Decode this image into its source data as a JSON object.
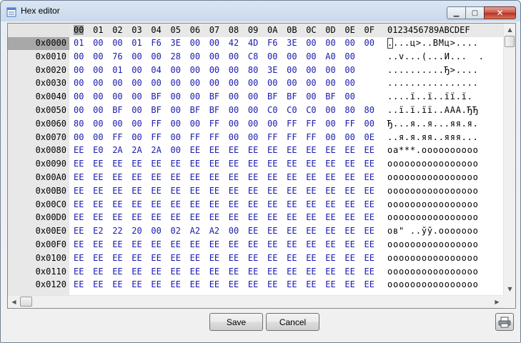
{
  "window": {
    "title": "Hex editor"
  },
  "header": {
    "columns": [
      "00",
      "01",
      "02",
      "03",
      "04",
      "05",
      "06",
      "07",
      "08",
      "09",
      "0A",
      "0B",
      "0C",
      "0D",
      "0E",
      "0F"
    ],
    "ascii_header": "0123456789ABCDEF"
  },
  "rows": [
    {
      "addr": "0x0000",
      "bytes": [
        "01",
        "00",
        "00",
        "01",
        "F6",
        "3E",
        "00",
        "00",
        "42",
        "4D",
        "F6",
        "3E",
        "00",
        "00",
        "00",
        "00"
      ],
      "ascii": "....ц>..BMц>...."
    },
    {
      "addr": "0x0010",
      "bytes": [
        "00",
        "00",
        "76",
        "00",
        "00",
        "28",
        "00",
        "00",
        "00",
        "C8",
        "00",
        "00",
        "00",
        "A0",
        "00",
        ""
      ],
      "ascii": "..v...(...И...  ."
    },
    {
      "addr": "0x0020",
      "bytes": [
        "00",
        "00",
        "01",
        "00",
        "04",
        "00",
        "00",
        "00",
        "00",
        "80",
        "3E",
        "00",
        "00",
        "00",
        "00",
        ""
      ],
      "ascii": "..........Ђ>...."
    },
    {
      "addr": "0x0030",
      "bytes": [
        "00",
        "00",
        "00",
        "00",
        "00",
        "00",
        "00",
        "00",
        "00",
        "00",
        "00",
        "00",
        "00",
        "00",
        "00",
        ""
      ],
      "ascii": "................"
    },
    {
      "addr": "0x0040",
      "bytes": [
        "00",
        "00",
        "00",
        "00",
        "BF",
        "00",
        "00",
        "BF",
        "00",
        "00",
        "BF",
        "BF",
        "00",
        "BF",
        "00",
        ""
      ],
      "ascii": "....ї..ї..її.ї."
    },
    {
      "addr": "0x0050",
      "bytes": [
        "00",
        "00",
        "BF",
        "00",
        "BF",
        "00",
        "BF",
        "BF",
        "00",
        "00",
        "C0",
        "C0",
        "C0",
        "00",
        "80",
        "80"
      ],
      "ascii": "..ї.ї.її..ААА.ЂЂ"
    },
    {
      "addr": "0x0060",
      "bytes": [
        "80",
        "00",
        "00",
        "00",
        "FF",
        "00",
        "00",
        "FF",
        "00",
        "00",
        "00",
        "FF",
        "FF",
        "00",
        "FF",
        "00"
      ],
      "ascii": "Ђ...я..я...яя.я."
    },
    {
      "addr": "0x0070",
      "bytes": [
        "00",
        "00",
        "FF",
        "00",
        "FF",
        "00",
        "FF",
        "FF",
        "00",
        "00",
        "FF",
        "FF",
        "FF",
        "00",
        "00",
        "0E"
      ],
      "ascii": "..я.я.яя..яяя..."
    },
    {
      "addr": "0x0080",
      "bytes": [
        "EE",
        "E0",
        "2A",
        "2A",
        "2A",
        "00",
        "EE",
        "EE",
        "EE",
        "EE",
        "EE",
        "EE",
        "EE",
        "EE",
        "EE",
        "EE"
      ],
      "ascii": "оа***.oooooooooo"
    },
    {
      "addr": "0x0090",
      "bytes": [
        "EE",
        "EE",
        "EE",
        "EE",
        "EE",
        "EE",
        "EE",
        "EE",
        "EE",
        "EE",
        "EE",
        "EE",
        "EE",
        "EE",
        "EE",
        "EE"
      ],
      "ascii": "oooooooooooooooo"
    },
    {
      "addr": "0x00A0",
      "bytes": [
        "EE",
        "EE",
        "EE",
        "EE",
        "EE",
        "EE",
        "EE",
        "EE",
        "EE",
        "EE",
        "EE",
        "EE",
        "EE",
        "EE",
        "EE",
        "EE"
      ],
      "ascii": "oooooooooooooooo"
    },
    {
      "addr": "0x00B0",
      "bytes": [
        "EE",
        "EE",
        "EE",
        "EE",
        "EE",
        "EE",
        "EE",
        "EE",
        "EE",
        "EE",
        "EE",
        "EE",
        "EE",
        "EE",
        "EE",
        "EE"
      ],
      "ascii": "oooooooooooooooo"
    },
    {
      "addr": "0x00C0",
      "bytes": [
        "EE",
        "EE",
        "EE",
        "EE",
        "EE",
        "EE",
        "EE",
        "EE",
        "EE",
        "EE",
        "EE",
        "EE",
        "EE",
        "EE",
        "EE",
        "EE"
      ],
      "ascii": "oooooooooooooooo"
    },
    {
      "addr": "0x00D0",
      "bytes": [
        "EE",
        "EE",
        "EE",
        "EE",
        "EE",
        "EE",
        "EE",
        "EE",
        "EE",
        "EE",
        "EE",
        "EE",
        "EE",
        "EE",
        "EE",
        "EE"
      ],
      "ascii": "oooooooooooooooo"
    },
    {
      "addr": "0x00E0",
      "bytes": [
        "EE",
        "E2",
        "22",
        "20",
        "00",
        "02",
        "A2",
        "A2",
        "00",
        "EE",
        "EE",
        "EE",
        "EE",
        "EE",
        "EE",
        "EE"
      ],
      "ascii": "ов\" ..ўў.ooooooo"
    },
    {
      "addr": "0x00F0",
      "bytes": [
        "EE",
        "EE",
        "EE",
        "EE",
        "EE",
        "EE",
        "EE",
        "EE",
        "EE",
        "EE",
        "EE",
        "EE",
        "EE",
        "EE",
        "EE",
        "EE"
      ],
      "ascii": "oooooooooooooooo"
    },
    {
      "addr": "0x0100",
      "bytes": [
        "EE",
        "EE",
        "EE",
        "EE",
        "EE",
        "EE",
        "EE",
        "EE",
        "EE",
        "EE",
        "EE",
        "EE",
        "EE",
        "EE",
        "EE",
        "EE"
      ],
      "ascii": "oooooooooooooooo"
    },
    {
      "addr": "0x0110",
      "bytes": [
        "EE",
        "EE",
        "EE",
        "EE",
        "EE",
        "EE",
        "EE",
        "EE",
        "EE",
        "EE",
        "EE",
        "EE",
        "EE",
        "EE",
        "EE",
        "EE"
      ],
      "ascii": "oooooooooooooooo"
    },
    {
      "addr": "0x0120",
      "bytes": [
        "EE",
        "EE",
        "EE",
        "EE",
        "EE",
        "EE",
        "EE",
        "EE",
        "EE",
        "EE",
        "EE",
        "EE",
        "EE",
        "EE",
        "EE",
        "EE"
      ],
      "ascii": "oooooooooooooooo"
    }
  ],
  "buttons": {
    "save": "Save",
    "cancel": "Cancel"
  },
  "icons": {
    "app": "hex-editor-app-icon",
    "print": "printer-icon"
  },
  "colors": {
    "byte_text": "#1a1ab0",
    "selection_gray": "#a8a8a8"
  }
}
